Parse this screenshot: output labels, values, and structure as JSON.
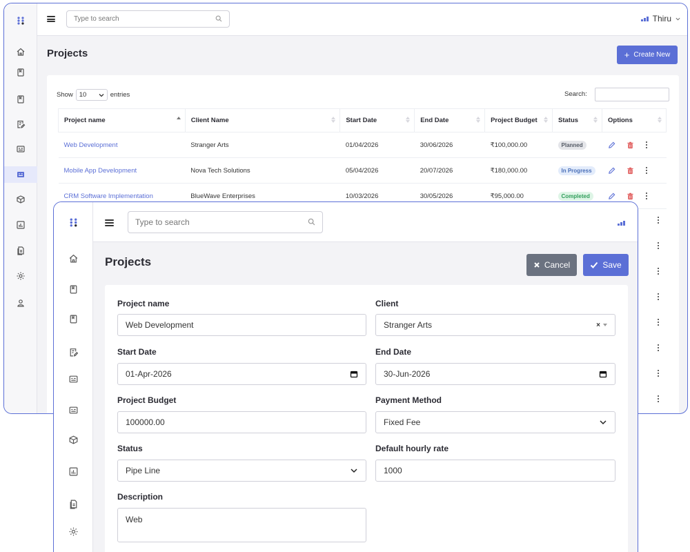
{
  "back": {
    "search": {
      "placeholder": "Type to search"
    },
    "user": {
      "name": "Thiru"
    },
    "page_title": "Projects",
    "create_label": "Create New",
    "show_label": "Show",
    "entries_value": "10",
    "entries_label": "entries",
    "search_label": "Search:",
    "columns": [
      "Project name",
      "Client Name",
      "Start Date",
      "End Date",
      "Project Budget",
      "Status",
      "Options"
    ],
    "rows": [
      {
        "name": "Web Development",
        "client": "Stranger Arts",
        "start": "01/04/2026",
        "end": "30/06/2026",
        "budget": "₹100,000.00",
        "status": "Planned"
      },
      {
        "name": "Mobile App Development",
        "client": "Nova Tech Solutions",
        "start": "05/04/2026",
        "end": "20/07/2026",
        "budget": "₹180,000.00",
        "status": "In Progress"
      },
      {
        "name": "CRM Software Implementation",
        "client": "BlueWave Enterprises",
        "start": "10/03/2026",
        "end": "30/05/2026",
        "budget": "₹95,000.00",
        "status": "Completed"
      }
    ],
    "status_colors": {
      "Planned": {
        "bg": "#e4e5e9",
        "fg": "#555b66"
      },
      "In Progress": {
        "bg": "#e3ecfb",
        "fg": "#4a6fb8"
      },
      "Completed": {
        "bg": "#def5e6",
        "fg": "#2f9d5a"
      }
    }
  },
  "front": {
    "search": {
      "placeholder": "Type to search"
    },
    "page_title": "Projects",
    "cancel_label": "Cancel",
    "save_label": "Save",
    "form": {
      "project_name_label": "Project name",
      "project_name_value": "Web Development",
      "client_label": "Client",
      "client_value": "Stranger Arts",
      "start_date_label": "Start Date",
      "start_date_value": "01-Apr-2026",
      "end_date_label": "End Date",
      "end_date_value": "30-Jun-2026",
      "budget_label": "Project Budget",
      "budget_value": "100000.00",
      "payment_label": "Payment Method",
      "payment_value": "Fixed Fee",
      "status_label": "Status",
      "status_value": "Pipe Line",
      "rate_label": "Default hourly rate",
      "rate_value": "1000",
      "description_label": "Description",
      "description_value": "Web"
    }
  },
  "colors": {
    "accent": "#5b6fd6",
    "cancel": "#6b7280",
    "link": "#5b6fd6",
    "delete": "#e05a5a"
  },
  "icons": {
    "sidebar": [
      "home-icon",
      "book-icon",
      "book-icon",
      "edit-note-icon",
      "card-icon",
      "card-icon",
      "box-icon",
      "chart-icon",
      "document-icon",
      "gear-icon",
      "user-icon"
    ],
    "row_actions": [
      "pencil-icon",
      "trash-icon",
      "kebab-icon"
    ]
  }
}
